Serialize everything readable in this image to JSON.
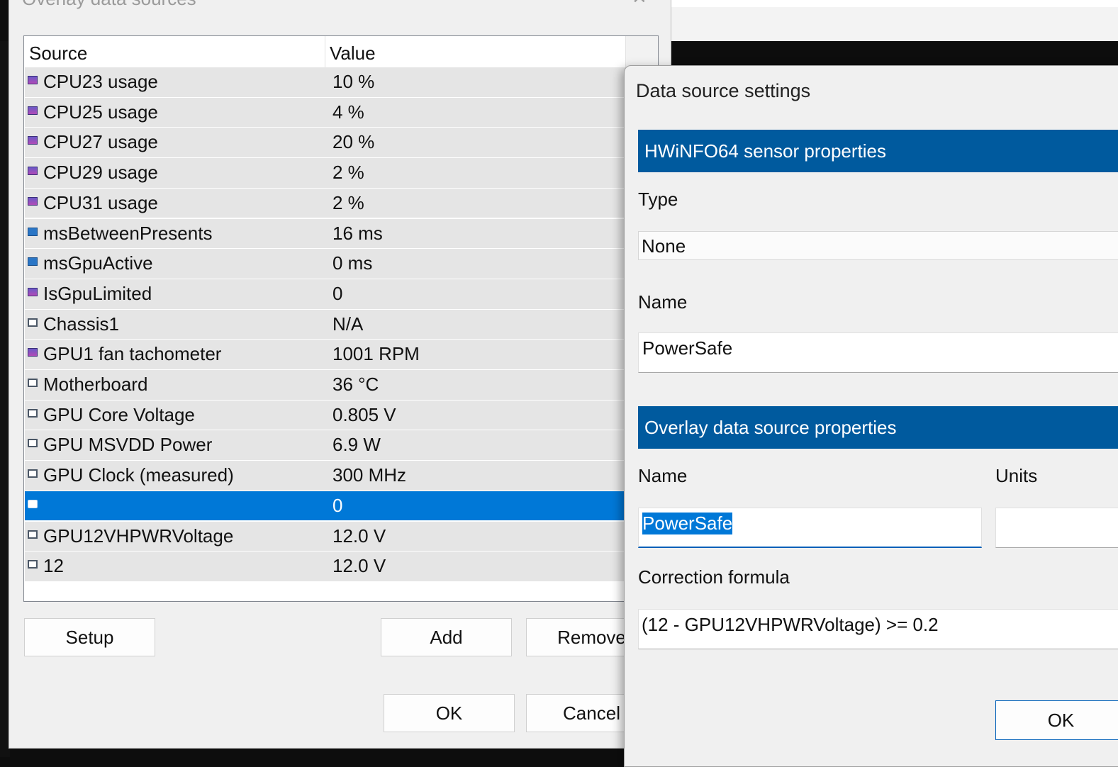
{
  "main_dialog": {
    "title": "Overlay data sources",
    "close_glyph": "✕",
    "columns": {
      "source": "Source",
      "value": "Value"
    },
    "rows": [
      {
        "source": "CPU23 usage",
        "value": "10 %",
        "icon": "cpu-sensor-icon",
        "selected": false
      },
      {
        "source": "CPU25 usage",
        "value": "4 %",
        "icon": "cpu-sensor-icon",
        "selected": false
      },
      {
        "source": "CPU27 usage",
        "value": "20 %",
        "icon": "cpu-sensor-icon",
        "selected": false
      },
      {
        "source": "CPU29 usage",
        "value": "2 %",
        "icon": "cpu-sensor-icon",
        "selected": false
      },
      {
        "source": "CPU31 usage",
        "value": "2 %",
        "icon": "cpu-sensor-icon",
        "selected": false
      },
      {
        "source": "msBetweenPresents",
        "value": "16 ms",
        "icon": "monitor-icon",
        "selected": false
      },
      {
        "source": "msGpuActive",
        "value": "0 ms",
        "icon": "monitor-icon",
        "selected": false
      },
      {
        "source": "IsGpuLimited",
        "value": "0",
        "icon": "cpu-sensor-icon",
        "selected": false
      },
      {
        "source": "Chassis1",
        "value": "N/A",
        "icon": "hwinfo-icon",
        "selected": false
      },
      {
        "source": "GPU1 fan tachometer",
        "value": "1001 RPM",
        "icon": "cpu-sensor-icon",
        "selected": false
      },
      {
        "source": "Motherboard",
        "value": "36 °C",
        "icon": "hwinfo-icon",
        "selected": false
      },
      {
        "source": "GPU Core Voltage",
        "value": "0.805 V",
        "icon": "hwinfo-icon",
        "selected": false
      },
      {
        "source": "GPU MSVDD Power",
        "value": "6.9 W",
        "icon": "hwinfo-icon",
        "selected": false
      },
      {
        "source": "GPU Clock (measured)",
        "value": "300 MHz",
        "icon": "hwinfo-icon",
        "selected": false
      },
      {
        "source": "",
        "value": "0",
        "icon": "hwinfo-icon",
        "selected": true
      },
      {
        "source": "GPU12VHPWRVoltage",
        "value": "12.0 V",
        "icon": "hwinfo-icon",
        "selected": false
      },
      {
        "source": "12",
        "value": "12.0 V",
        "icon": "hwinfo-icon",
        "selected": false
      }
    ],
    "buttons": {
      "setup": "Setup",
      "add": "Add",
      "remove": "Remove",
      "ok": "OK",
      "cancel": "Cancel"
    }
  },
  "settings_dialog": {
    "title": "Data source settings",
    "hwinfo_section": "HWiNFO64 sensor properties",
    "type_label": "Type",
    "type_value": "None",
    "name_label": "Name",
    "name_value": "PowerSafe",
    "overlay_section": "Overlay data source properties",
    "overlay_name_label": "Name",
    "overlay_name_value": "PowerSafe",
    "units_label": "Units",
    "units_value": "",
    "formula_label": "Correction formula",
    "formula_value": "(12 - GPU12VHPWRVoltage) >= 0.2",
    "ok": "OK"
  },
  "colors": {
    "selection": "#0078d7",
    "section_bar": "#005a9e",
    "dialog_bg": "#f0f0f0"
  }
}
